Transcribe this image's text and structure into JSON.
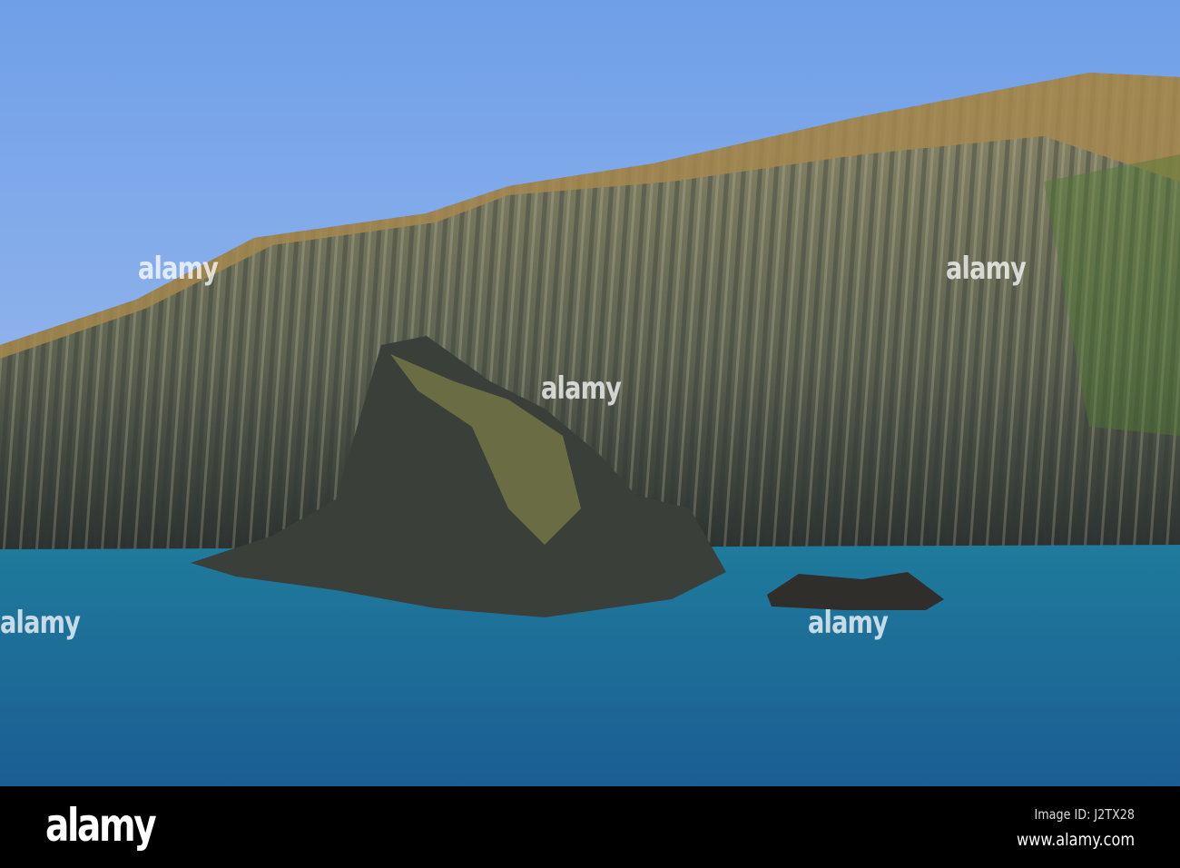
{
  "photo": {
    "subject": "Coastal cliffs and sea",
    "colors": {
      "sky_top": "#6f9fe8",
      "sky_bottom": "#a9c4ef",
      "sea": "#1d6a96",
      "cliff": "#6b6a52",
      "grass": "#a5874f"
    }
  },
  "watermark": {
    "text": "alamy"
  },
  "footer": {
    "logo": "alamy",
    "image_id": "Image ID: J2TX28",
    "url": "www.alamy.com"
  }
}
